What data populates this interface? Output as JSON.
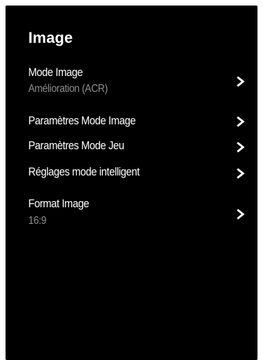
{
  "menu": {
    "title": "Image",
    "items": [
      {
        "label": "Mode Image",
        "value": "Amélioration (ACR)",
        "icon": "chevron-right-icon"
      },
      {
        "label": "Paramètres Mode Image",
        "icon": "chevron-right-icon"
      },
      {
        "label": "Paramètres Mode Jeu",
        "icon": "chevron-right-icon"
      },
      {
        "label": "Réglages mode intelligent",
        "icon": "chevron-right-icon"
      },
      {
        "label": "Format Image",
        "value": "16:9",
        "icon": "chevron-right-icon"
      }
    ]
  },
  "colors": {
    "background": "#000000",
    "text": "#ffffff",
    "secondary_text": "#8f8f8f"
  }
}
